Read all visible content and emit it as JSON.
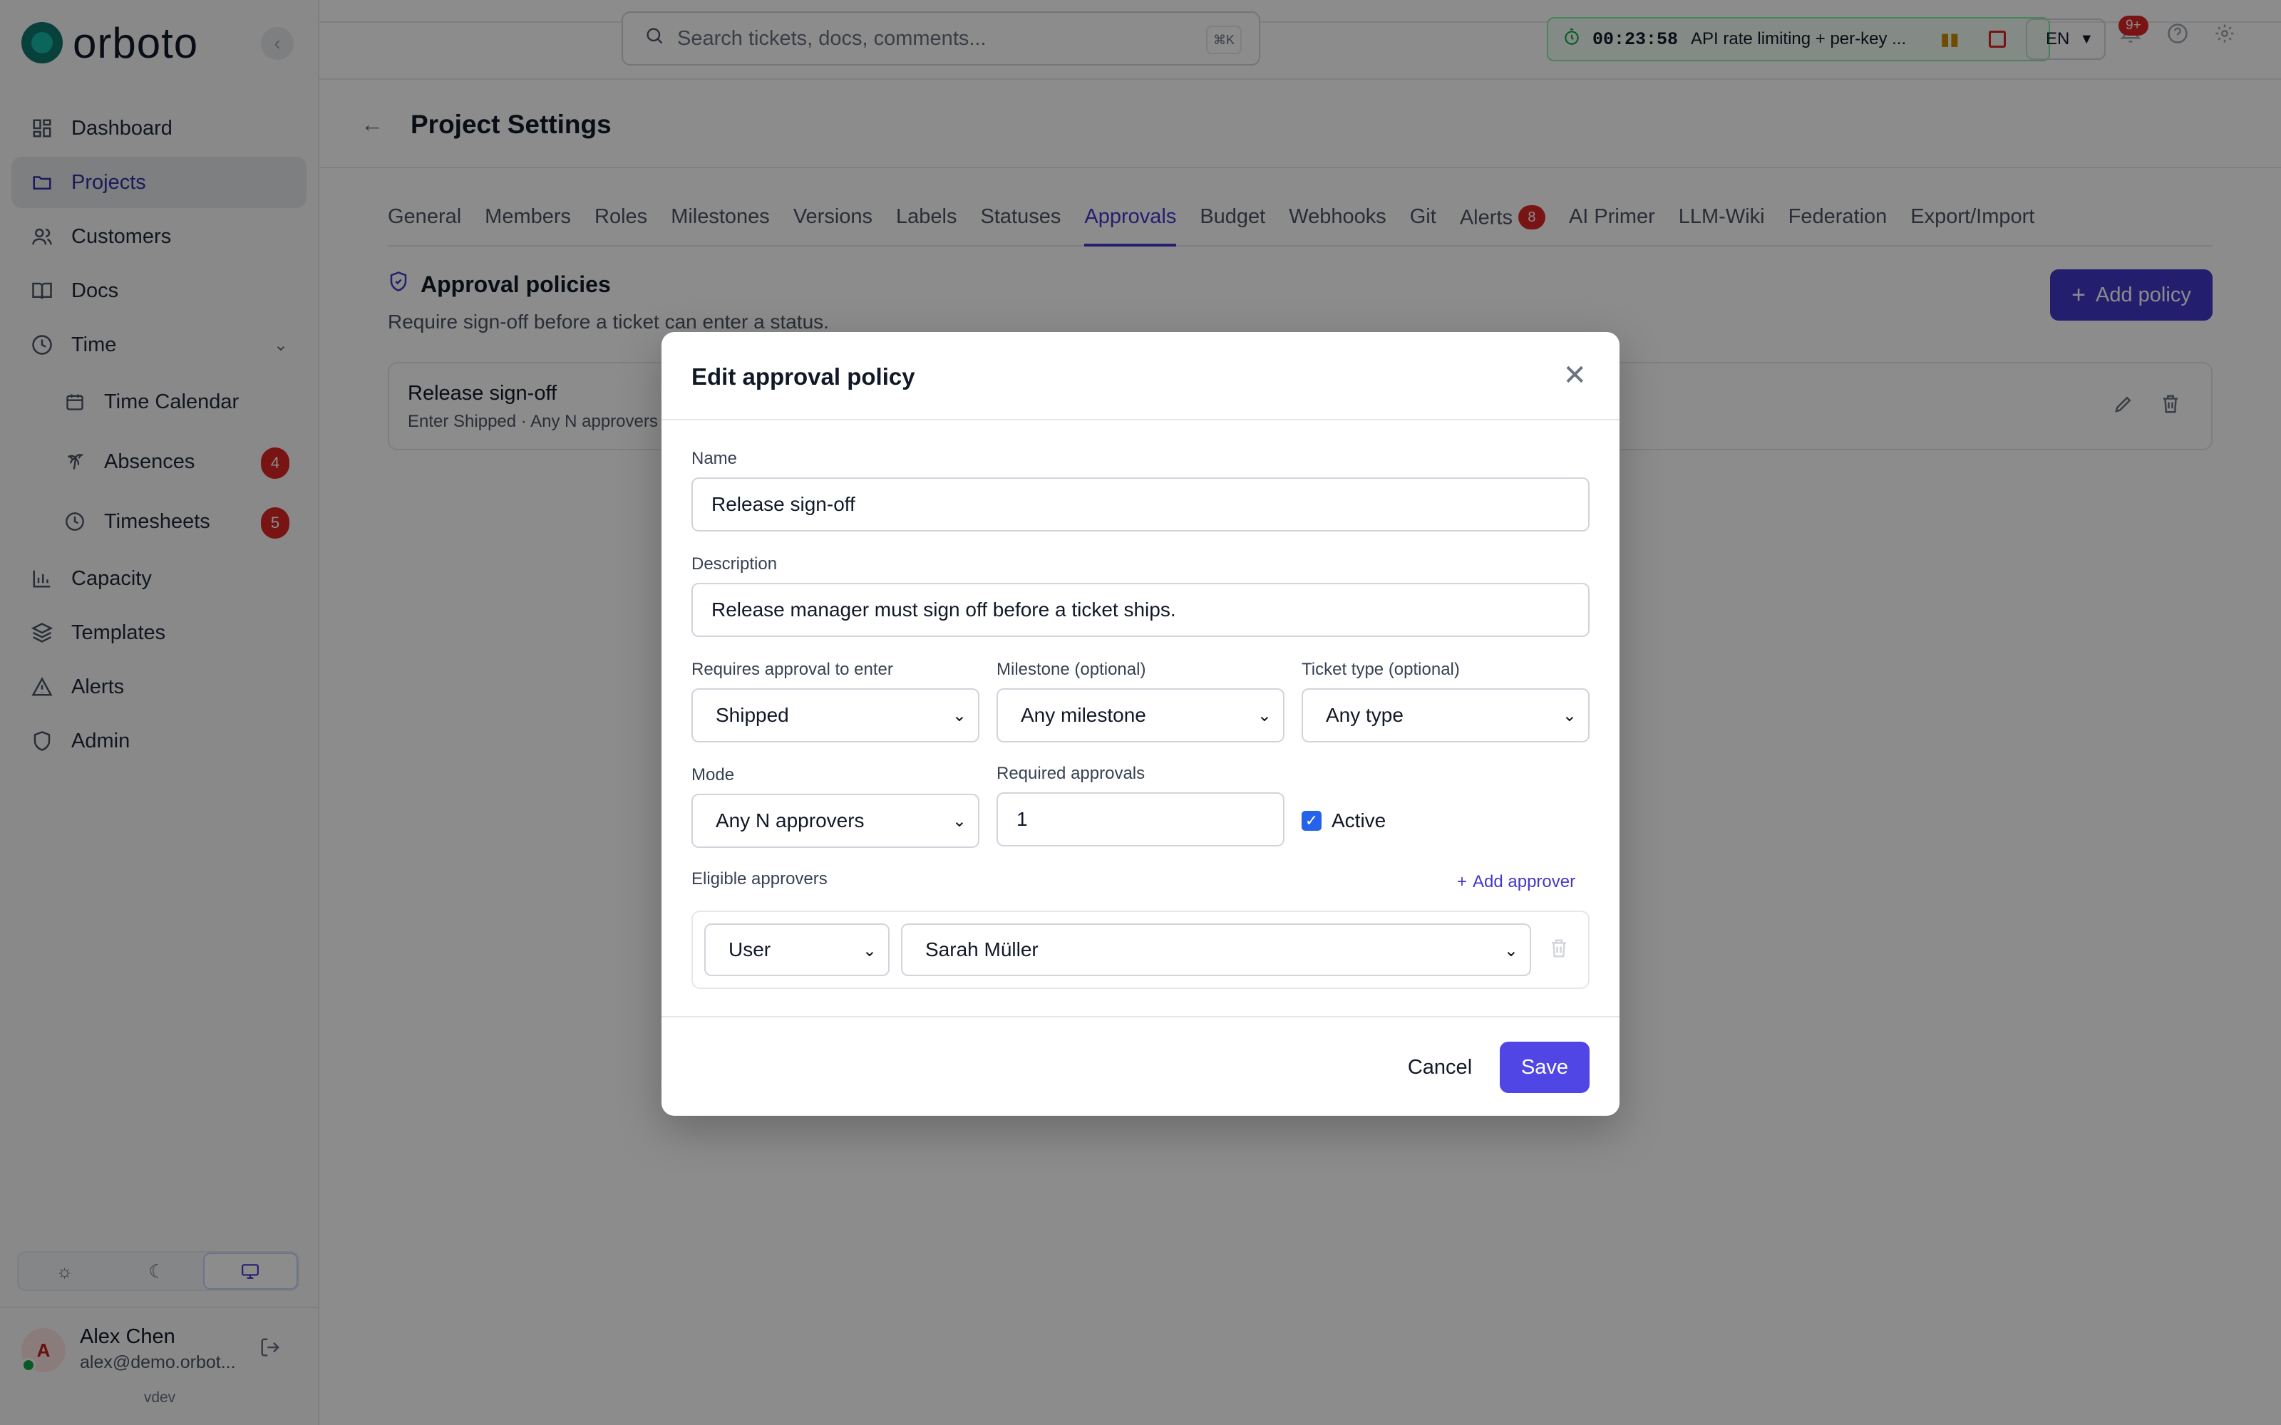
{
  "app": {
    "logo_text": "orboto",
    "version": "vdev"
  },
  "sidebar": {
    "items": [
      {
        "label": "Dashboard",
        "icon": "dashboard-icon"
      },
      {
        "label": "Projects",
        "icon": "folder-icon",
        "active": true
      },
      {
        "label": "Customers",
        "icon": "users-icon"
      },
      {
        "label": "Docs",
        "icon": "book-icon"
      },
      {
        "label": "Time",
        "icon": "clock-icon",
        "expanded": true
      },
      {
        "label": "Time Calendar",
        "icon": "calendar-icon",
        "sub": true
      },
      {
        "label": "Absences",
        "icon": "palm-tree-icon",
        "sub": true,
        "badge": "4"
      },
      {
        "label": "Timesheets",
        "icon": "clock-icon",
        "sub": true,
        "badge": "5"
      },
      {
        "label": "Capacity",
        "icon": "bar-chart-icon"
      },
      {
        "label": "Templates",
        "icon": "layers-icon"
      },
      {
        "label": "Alerts",
        "icon": "alert-triangle-icon"
      },
      {
        "label": "Admin",
        "icon": "shield-icon"
      }
    ],
    "theme": {
      "selected": "system"
    },
    "user": {
      "initial": "A",
      "name": "Alex Chen",
      "email": "alex@demo.orbot..."
    }
  },
  "topbar": {
    "search_placeholder": "Search tickets, docs, comments...",
    "search_shortcut": "⌘K",
    "timer": {
      "time": "00:23:58",
      "description": "API rate limiting + per-key ..."
    },
    "language": "EN",
    "notifications_badge": "9+"
  },
  "header": {
    "title": "Project Settings"
  },
  "tabs": [
    {
      "label": "General"
    },
    {
      "label": "Members"
    },
    {
      "label": "Roles"
    },
    {
      "label": "Milestones"
    },
    {
      "label": "Versions"
    },
    {
      "label": "Labels"
    },
    {
      "label": "Statuses"
    },
    {
      "label": "Approvals",
      "active": true
    },
    {
      "label": "Budget"
    },
    {
      "label": "Webhooks"
    },
    {
      "label": "Git"
    },
    {
      "label": "Alerts",
      "badge": "8"
    },
    {
      "label": "AI Primer"
    },
    {
      "label": "LLM-Wiki"
    },
    {
      "label": "Federation"
    },
    {
      "label": "Export/Import"
    }
  ],
  "section": {
    "title": "Approval policies",
    "subtitle": "Require sign-off before a ticket can enter a status.",
    "add_label": "Add policy"
  },
  "policy": {
    "name": "Release sign-off",
    "meta": "Enter Shipped · Any N approvers"
  },
  "modal": {
    "title": "Edit approval policy",
    "name_label": "Name",
    "name_value": "Release sign-off",
    "description_label": "Description",
    "description_value": "Release manager must sign off before a ticket ships.",
    "status_label": "Requires approval to enter",
    "status_value": "Shipped",
    "milestone_label": "Milestone (optional)",
    "milestone_value": "Any milestone",
    "type_label": "Ticket type (optional)",
    "type_value": "Any type",
    "mode_label": "Mode",
    "mode_value": "Any N approvers",
    "required_label": "Required approvals",
    "required_value": "1",
    "active_label": "Active",
    "active_checked": true,
    "approvers_label": "Eligible approvers",
    "add_approver_label": "Add approver",
    "approver_kind": "User",
    "approver_name": "Sarah Müller",
    "cancel_label": "Cancel",
    "save_label": "Save"
  },
  "colors": {
    "accent": "#4338ca",
    "badge": "#dc2626",
    "timer_border": "#86efac"
  }
}
